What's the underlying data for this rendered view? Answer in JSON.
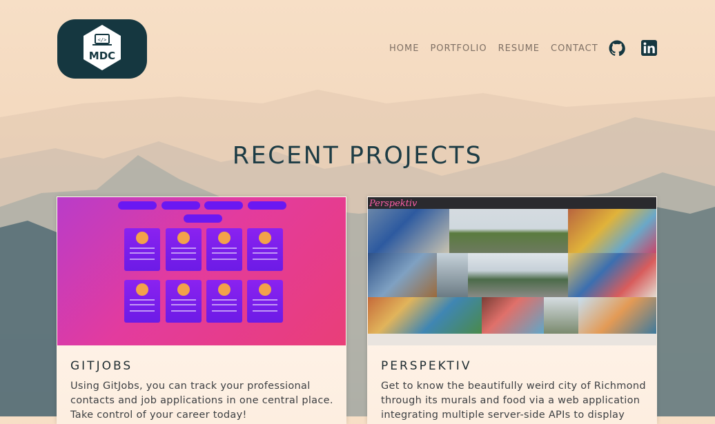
{
  "logo": {
    "text": "MDC",
    "icon": "code-laptop-icon"
  },
  "nav": {
    "items": [
      "HOME",
      "PORTFOLIO",
      "RESUME",
      "CONTACT"
    ]
  },
  "social": {
    "github_icon": "github-icon",
    "linkedin_icon": "linkedin-icon"
  },
  "page_title": "RECENT PROJECTS",
  "projects": [
    {
      "title": "GITJOBS",
      "description": "Using GitJobs, you can track your professional contacts and job applications in one central place. Take control of your career today!",
      "thumbnail": "gitjobs-screenshot"
    },
    {
      "title": "PERSPEKTIV",
      "description": "Get to know the beautifully weird city of Richmond through its murals and food via a web application integrating multiple server-side APIs to display",
      "thumbnail": "perspektiv-screenshot"
    }
  ],
  "colors": {
    "accent": "#153740",
    "title": "#1d3c45",
    "nav": "#7e6f64"
  }
}
